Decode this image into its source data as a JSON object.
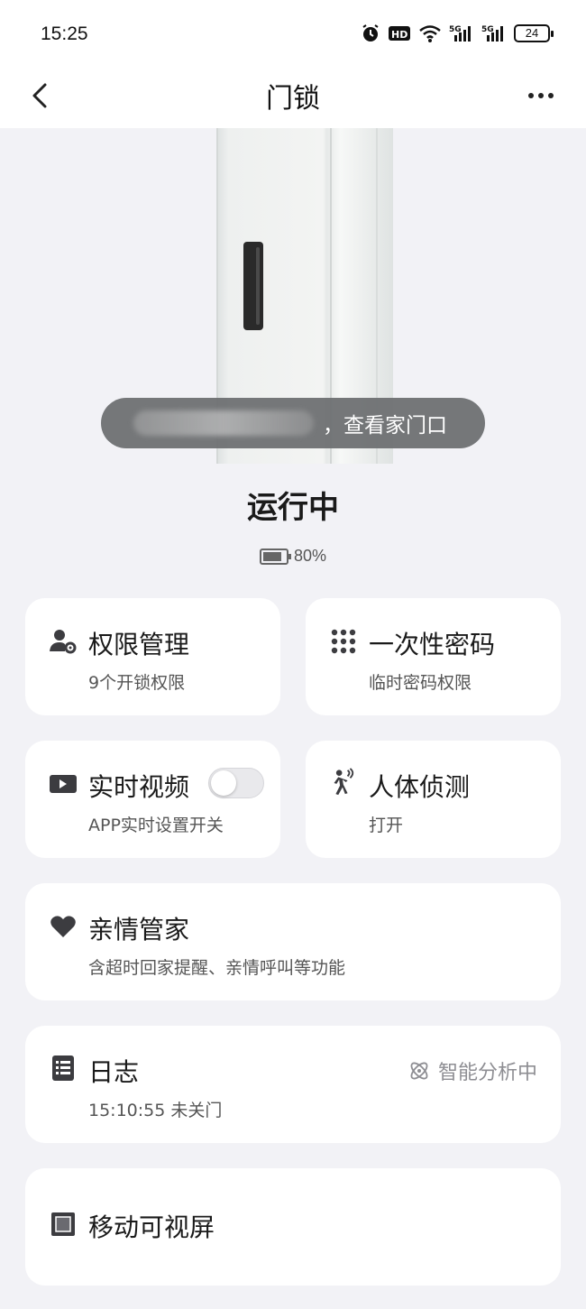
{
  "status_bar": {
    "time": "15:25",
    "battery_level": "24",
    "icons": [
      "alarm-icon",
      "hd-icon",
      "wifi-icon",
      "5g-signal-icon",
      "5g-signal-icon",
      "battery-icon"
    ]
  },
  "nav": {
    "title": "门锁",
    "back_icon": "chevron-left-icon",
    "more_icon": "more-dots-icon"
  },
  "door": {
    "view_pill_text": "，查看家门口"
  },
  "device": {
    "status": "运行中",
    "battery": "80%"
  },
  "cards": {
    "permissions": {
      "title": "权限管理",
      "subtitle": "9个开锁权限",
      "icon": "user-settings-icon"
    },
    "otp": {
      "title": "一次性密码",
      "subtitle": "临时密码权限",
      "icon": "keypad-icon"
    },
    "live_video": {
      "title": "实时视频",
      "subtitle": "APP实时设置开关",
      "icon": "video-camera-icon",
      "toggle_on": false
    },
    "motion": {
      "title": "人体侦测",
      "subtitle": "打开",
      "icon": "motion-person-icon"
    },
    "family": {
      "title": "亲情管家",
      "subtitle": "含超时回家提醒、亲情呼叫等功能",
      "icon": "heart-icon"
    },
    "log": {
      "title": "日志",
      "subtitle": "15:10:55 未关门",
      "icon": "list-icon",
      "badge": "智能分析中",
      "badge_icon": "atom-icon"
    },
    "screen": {
      "title": "移动可视屏",
      "icon": "screen-square-icon"
    }
  },
  "colors": {
    "background": "#f2f2f6",
    "card": "#ffffff",
    "icon": "#3c3c40",
    "muted": "#8e8e93"
  }
}
